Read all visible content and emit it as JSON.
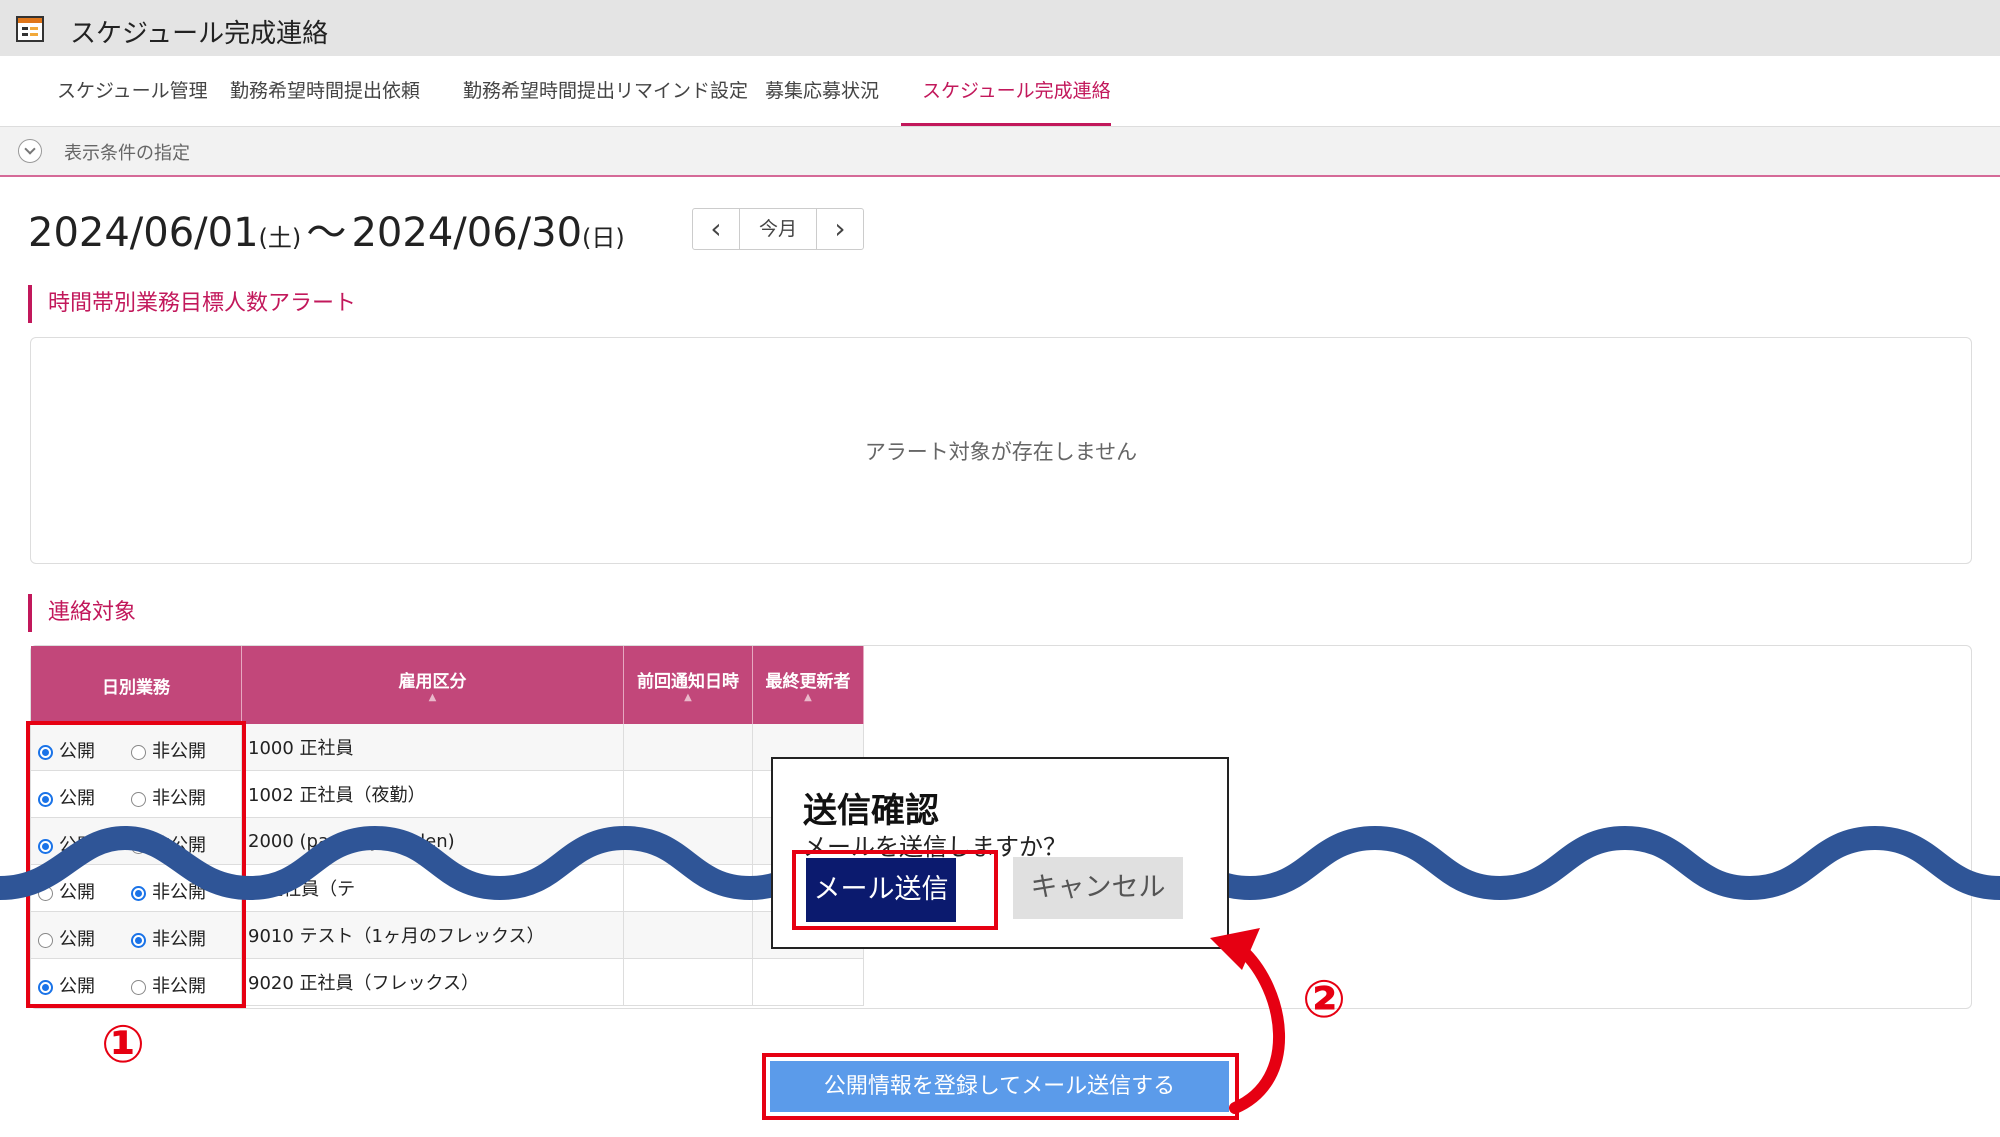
{
  "app": {
    "title": "スケジュール完成連絡"
  },
  "tabs": [
    {
      "label": "スケジュール管理"
    },
    {
      "label": "勤務希望時間提出依頼"
    },
    {
      "label": "勤務希望時間提出リマインド設定"
    },
    {
      "label": "募集応募状況"
    },
    {
      "label": "スケジュール完成連絡",
      "active": true
    }
  ],
  "filter": {
    "label": "表示条件の指定"
  },
  "period": {
    "start": "2024/06/01",
    "start_day": "(土)",
    "separator": "～",
    "end": "2024/06/30",
    "end_day": "(日)"
  },
  "nav": {
    "prev": "‹",
    "today": "今月",
    "next": "›"
  },
  "alert_section": {
    "title": "時間帯別業務目標人数アラート",
    "empty_message": "アラート対象が存在しません"
  },
  "contacts": {
    "title": "連絡対象",
    "headers": {
      "daily": "日別業務",
      "employment": "雇用区分",
      "last_notified": "前回通知日時",
      "last_updated_by": "最終更新者"
    },
    "option_public": "公開",
    "option_private": "非公開",
    "rows": [
      {
        "employment": "1000 正社員",
        "selected": "public"
      },
      {
        "employment": "1002 正社員（夜勤）",
        "selected": "public"
      },
      {
        "employment": "2000 (partially hidden)",
        "selected": "public"
      },
      {
        "employment": "0 正社員（テ",
        "selected": "private"
      },
      {
        "employment": "9010 テスト（1ヶ月のフレックス）",
        "selected": "private"
      },
      {
        "employment": "9020 正社員（フレックス）",
        "selected": "public"
      }
    ]
  },
  "dialog": {
    "title": "送信確認",
    "message": "メールを送信しますか？",
    "send_label": "メール送信",
    "cancel_label": "キャンセル"
  },
  "submit": {
    "label": "公開情報を登録してメール送信する"
  },
  "annotations": {
    "step1": "①",
    "step2": "②"
  },
  "colors": {
    "accent": "#c2185b",
    "header": "#c2477a",
    "highlight": "#e60012",
    "primary_button": "#5b9bea",
    "wave": "#2f5597",
    "dialog_send": "#0b1a6e"
  }
}
